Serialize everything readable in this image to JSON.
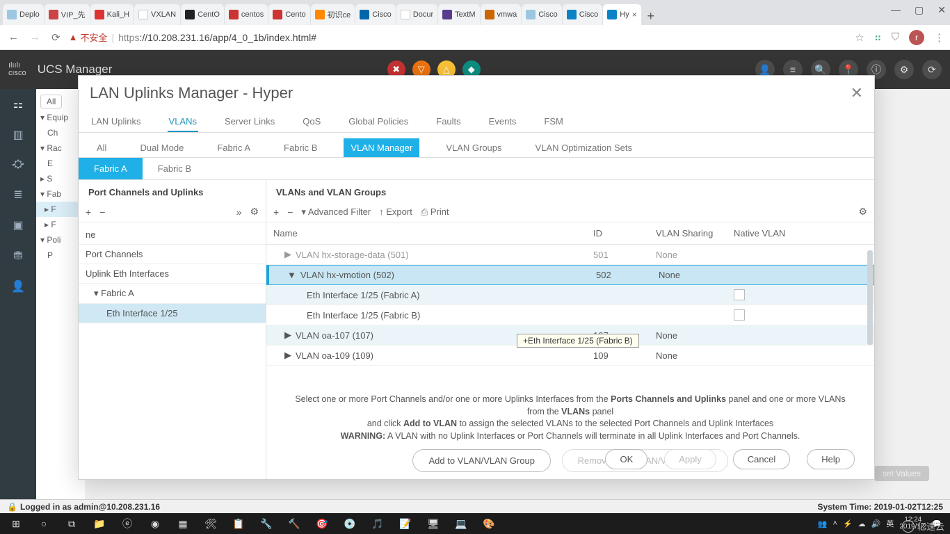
{
  "browser": {
    "tabs": [
      "Deplo",
      "VIP_先",
      "Kali_H",
      "VXLAN",
      "CentO",
      "centos",
      "Cento",
      "初识ce",
      "Cisco",
      "Docur",
      "TextM",
      "vmwa",
      "Cisco",
      "Cisco",
      "Hy"
    ],
    "active_tab_index": 14,
    "warn_label": "不安全",
    "url_https": "https",
    "url_rest": "://10.208.231.16/app/4_0_1b/index.html#",
    "avatar_letter": "r"
  },
  "ucs": {
    "title": "UCS Manager"
  },
  "bg_panel": {
    "header_all": "All",
    "items": [
      "Equip",
      "Ch",
      "Rac",
      "E",
      "S",
      "Fab",
      "F",
      "F",
      "Poli",
      "P"
    ],
    "sel_item": "F"
  },
  "modal": {
    "title": "LAN Uplinks Manager - Hyper",
    "tabs1": [
      "LAN Uplinks",
      "VLANs",
      "Server Links",
      "QoS",
      "Global Policies",
      "Faults",
      "Events",
      "FSM"
    ],
    "tabs1_active_index": 1,
    "tabs2": [
      "All",
      "Dual Mode",
      "Fabric A",
      "Fabric B",
      "VLAN Manager",
      "VLAN Groups",
      "VLAN Optimization Sets"
    ],
    "tabs2_active_index": 4,
    "tabs3": [
      "Fabric A",
      "Fabric B"
    ],
    "tabs3_active_index": 0,
    "left_title": "Port Channels and Uplinks",
    "right_title": "VLANs and VLAN Groups",
    "toolbar": {
      "advfilter": "Advanced Filter",
      "export": "Export",
      "print": "Print"
    },
    "left_tree": {
      "ne": "ne",
      "pc": "Port Channels",
      "uplink": "Uplink Eth Interfaces",
      "fabric_a": "Fabric A",
      "eth": "Eth Interface 1/25"
    },
    "grid_headers": {
      "name": "Name",
      "id": "ID",
      "sharing": "VLAN Sharing",
      "native": "Native VLAN"
    },
    "rows": [
      {
        "name": "VLAN hx-storage-data (501)",
        "id": "501",
        "sharing": "None",
        "type": "vlan",
        "arrow": "▶",
        "dim": true
      },
      {
        "name": "VLAN hx-vmotion (502)",
        "id": "502",
        "sharing": "None",
        "type": "vlan",
        "arrow": "▼",
        "selected": true
      },
      {
        "name": "Eth Interface 1/25 (Fabric A)",
        "type": "eth",
        "checkbox": true,
        "alt": true
      },
      {
        "name": "Eth Interface 1/25 (Fabric B)",
        "type": "eth",
        "checkbox": true
      },
      {
        "name": "VLAN oa-107 (107)",
        "id": "107",
        "sharing": "None",
        "type": "vlan",
        "arrow": "▶",
        "alt": true
      },
      {
        "name": "VLAN oa-109 (109)",
        "id": "109",
        "sharing": "None",
        "type": "vlan",
        "arrow": "▶"
      }
    ],
    "tooltip": "+Eth Interface 1/25 (Fabric B)",
    "instructions": {
      "line1_a": "Select one or more Port Channels and/or one or more Uplinks Interfaces from the ",
      "line1_b": "Ports Channels and Uplinks",
      "line1_c": " panel and one or more VLANs from the ",
      "line1_d": "VLANs",
      "line1_e": " panel",
      "line2_a": "and click ",
      "line2_b": "Add to VLAN",
      "line2_c": " to assign the selected VLANs to the selected Port Channels and Uplink Interfaces",
      "line3_a": "WARNING:",
      "line3_b": " A VLAN with no Uplink Interfaces or Port Channels will terminate in all Uplink Interfaces and Port Channels."
    },
    "btn_add": "Add to VLAN/VLAN Group",
    "btn_remove": "Remove from VLAN/VLAN Group",
    "footer": {
      "ok": "OK",
      "apply": "Apply",
      "cancel": "Cancel",
      "help": "Help"
    }
  },
  "bg_btn": "set Values",
  "statusbar": {
    "left": "Logged in as admin@10.208.231.16",
    "right": "System Time: 2019-01-02T12:25"
  },
  "taskbar": {
    "clock_time": "12:24",
    "clock_date": "2019/1/2",
    "lang": "英"
  },
  "watermark": "亿速云"
}
